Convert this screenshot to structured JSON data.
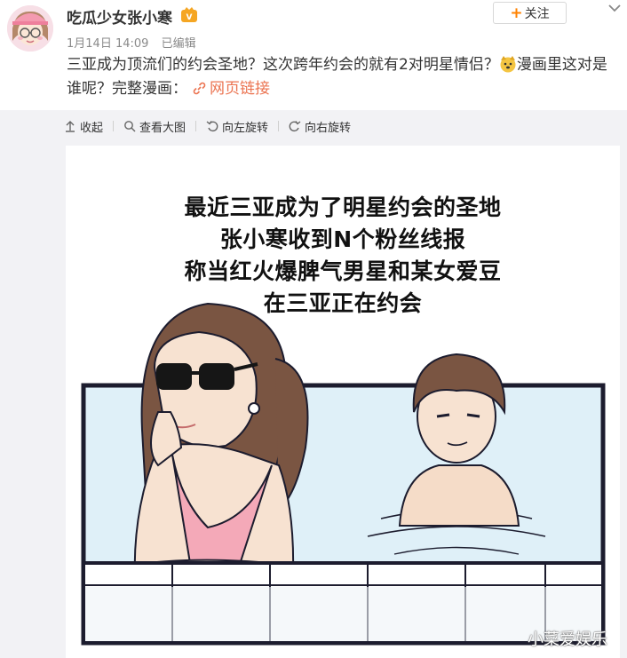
{
  "post": {
    "author": "吃瓜少女张小寒",
    "date": "1月14日 14:09",
    "edited": "已编辑",
    "follow_label": "关注",
    "text_part1": "三亚成为顶流们的约会圣地？这次跨年约会的就有2对明星情侣？",
    "text_part2": "漫画里这对是谁呢？完整漫画：",
    "link_label": "网页链接"
  },
  "toolbar": {
    "collapse": "收起",
    "view_large": "查看大图",
    "rotate_left": "向左旋转",
    "rotate_right": "向右旋转"
  },
  "comic": {
    "captions": [
      "最近三亚成为了明星约会的圣地",
      "张小寒收到N个粉丝线报",
      "称当红火爆脾气男星和某女爱豆",
      "在三亚正在约会"
    ]
  },
  "watermark": "小菜爱娱乐",
  "colors": {
    "link": "#eb7350",
    "follow_plus": "#ff8200",
    "panel_bg": "#f2f2f5",
    "water": "#dff0f8"
  },
  "icons": {
    "vip": "vip-badge-icon",
    "expand": "chevron-down-icon",
    "emoji": "dog-face-emoji-icon",
    "link": "link-icon"
  }
}
